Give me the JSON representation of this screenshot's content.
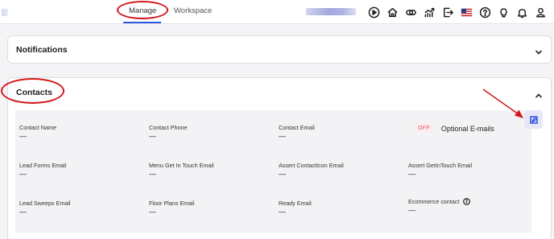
{
  "header": {
    "tabs": [
      {
        "label": "Manage",
        "active": true
      },
      {
        "label": "Workspace",
        "active": false
      }
    ],
    "icons": [
      "play-icon",
      "home-icon",
      "link-icon",
      "chart-icon",
      "logout-icon",
      "us-flag-icon",
      "help-icon",
      "bulb-icon",
      "bell-icon",
      "user-icon"
    ],
    "accent_color": "#2f56e0",
    "annotation_color": "#d3161c"
  },
  "sections": {
    "notifications": {
      "title": "Notifications"
    },
    "contacts": {
      "title": "Contacts",
      "fields": [
        {
          "label": "Contact Name",
          "value": "—"
        },
        {
          "label": "Contact Phone",
          "value": "—"
        },
        {
          "label": "Contact Email",
          "value": "—"
        },
        {
          "label": "Lead Forms Email",
          "value": "—"
        },
        {
          "label": "Menu Get In Touch Email",
          "value": "—"
        },
        {
          "label": "Assert ContactIcon Email",
          "value": "—"
        },
        {
          "label": "Assert GetInTouch Email",
          "value": "—"
        },
        {
          "label": "Lead Sweeps Email",
          "value": "—"
        },
        {
          "label": "Floor Plans Email",
          "value": "—"
        },
        {
          "label": "Ready Email",
          "value": "—"
        },
        {
          "label": "Ecommerce contact",
          "value": "—"
        }
      ],
      "optional_emails": {
        "status": "OFF",
        "label": "Optional E-mails",
        "status_color": "#e0556a"
      }
    }
  }
}
